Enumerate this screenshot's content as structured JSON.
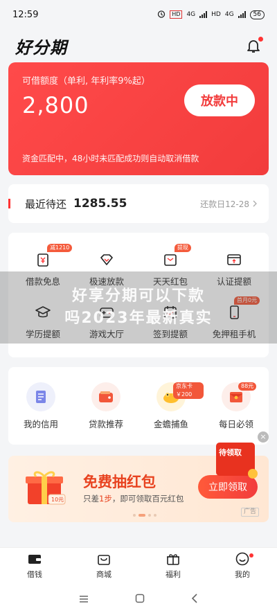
{
  "status_bar": {
    "time": "12:59",
    "hd1": "HD",
    "net1": "4G",
    "hd2": "HD",
    "net2": "4G",
    "battery": "56"
  },
  "header": {
    "brand": "好分期"
  },
  "loan_card": {
    "label": "可借额度（单利, 年利率9%起）",
    "amount": "2,800",
    "button": "放款中",
    "note": "资金匹配中，48小时未匹配成功则自动取消借款"
  },
  "repay": {
    "title": "最近待还",
    "amount": "1285.55",
    "date": "还款日12-28"
  },
  "grid": {
    "items": [
      {
        "label": "借款免息",
        "badge": "减1210"
      },
      {
        "label": "极速放款"
      },
      {
        "label": "天天红包",
        "badge": "提现"
      },
      {
        "label": "认证提额"
      },
      {
        "label": "学历提额"
      },
      {
        "label": "游戏大厅"
      },
      {
        "label": "签到提额"
      },
      {
        "label": "免押租手机",
        "badge": "首月0元"
      }
    ]
  },
  "watermark": {
    "line1": "好享分期可以下款",
    "line2": "吗2023年最新真实"
  },
  "services": {
    "items": [
      {
        "label": "我的信用"
      },
      {
        "label": "贷款推荐"
      },
      {
        "label": "金蟾捕鱼",
        "badge": "京东卡 ￥200"
      },
      {
        "label": "每日必领",
        "badge": "88元"
      }
    ]
  },
  "promo": {
    "tag": "待领取",
    "gift_value": "10元",
    "title": "免费抽红包",
    "sub_pre": "只差",
    "sub_hl": "1步",
    "sub_post": "，即可领取百元红包",
    "button": "立即领取",
    "ad": "广告"
  },
  "tabbar": {
    "items": [
      {
        "label": "借钱"
      },
      {
        "label": "商城"
      },
      {
        "label": "福利"
      },
      {
        "label": "我的"
      }
    ]
  },
  "colors": {
    "brand_red": "#f23c3c",
    "promo_orange": "#e8421f"
  }
}
